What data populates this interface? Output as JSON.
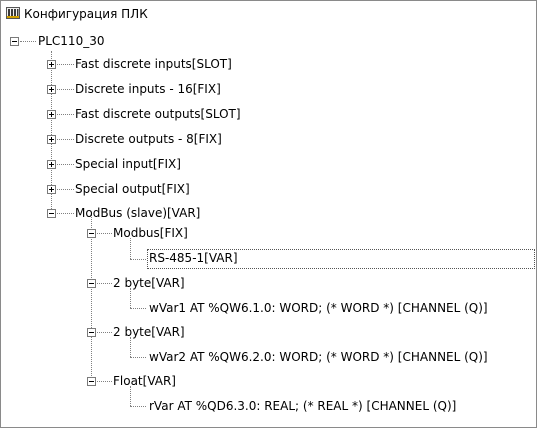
{
  "window": {
    "title": "Конфигурация ПЛК",
    "icon": "plc-config-icon"
  },
  "tree": {
    "root": {
      "label": "PLC110_30",
      "expanded": true,
      "children": [
        {
          "label": "Fast discrete inputs[SLOT]",
          "expanded": false
        },
        {
          "label": "Discrete inputs - 16[FIX]",
          "expanded": false
        },
        {
          "label": "Fast discrete outputs[SLOT]",
          "expanded": false
        },
        {
          "label": "Discrete outputs - 8[FIX]",
          "expanded": false
        },
        {
          "label": "Special input[FIX]",
          "expanded": false
        },
        {
          "label": "Special output[FIX]",
          "expanded": false
        },
        {
          "label": "ModBus (slave)[VAR]",
          "expanded": true,
          "children": [
            {
              "label": "Modbus[FIX]",
              "expanded": true,
              "children": [
                {
                  "label": "RS-485-1[VAR]",
                  "selected": true
                }
              ]
            },
            {
              "label": "2 byte[VAR]",
              "expanded": true,
              "children": [
                {
                  "label": "wVar1 AT %QW6.1.0: WORD; (* WORD *) [CHANNEL (Q)]"
                }
              ]
            },
            {
              "label": "2 byte[VAR]",
              "expanded": true,
              "children": [
                {
                  "label": "wVar2 AT %QW6.2.0: WORD; (* WORD *) [CHANNEL (Q)]"
                }
              ]
            },
            {
              "label": "Float[VAR]",
              "expanded": true,
              "children": [
                {
                  "label": "rVar AT %QD6.3.0: REAL; (* REAL *) [CHANNEL (Q)]"
                }
              ]
            }
          ]
        }
      ]
    }
  }
}
